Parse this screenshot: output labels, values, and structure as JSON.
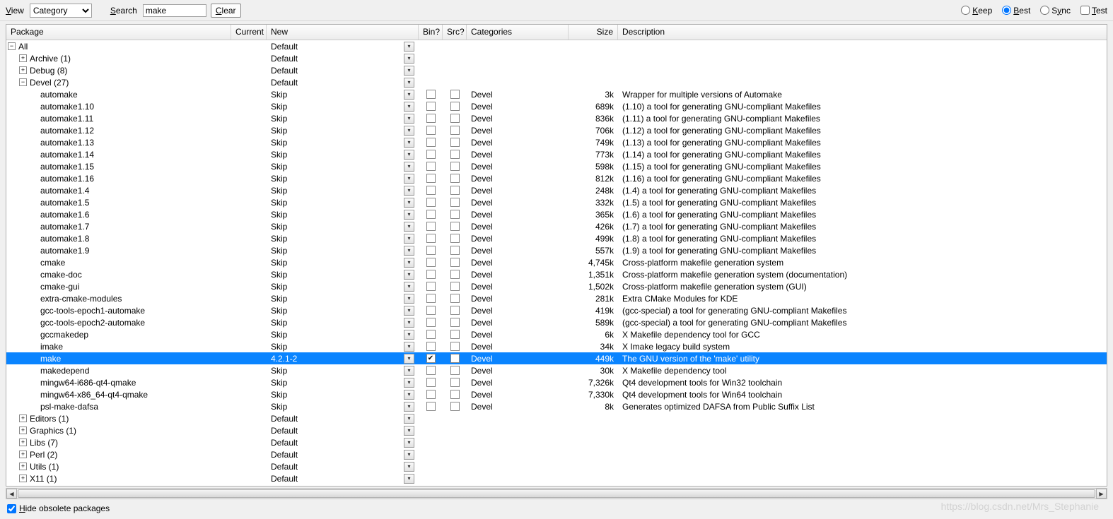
{
  "toolbar": {
    "view_label": "View",
    "view_value": "Category",
    "search_label": "Search",
    "search_value": "make",
    "clear_label": "Clear",
    "radio_keep": "Keep",
    "radio_best": "Best",
    "radio_sync": "Sync",
    "check_test": "Test"
  },
  "columns": {
    "package": "Package",
    "current": "Current",
    "new": "New",
    "bin": "Bin?",
    "src": "Src?",
    "categories": "Categories",
    "size": "Size",
    "description": "Description"
  },
  "rows": [
    {
      "type": "cat",
      "label": "All",
      "expanded": true,
      "indent": 0,
      "new": "Default"
    },
    {
      "type": "cat",
      "label": "Archive (1)",
      "expanded": false,
      "indent": 1,
      "new": "Default"
    },
    {
      "type": "cat",
      "label": "Debug (8)",
      "expanded": false,
      "indent": 1,
      "new": "Default"
    },
    {
      "type": "cat",
      "label": "Devel (27)",
      "expanded": true,
      "indent": 1,
      "new": "Default"
    },
    {
      "type": "pkg",
      "label": "automake",
      "new": "Skip",
      "cat": "Devel",
      "size": "3k",
      "desc": "Wrapper for multiple versions of Automake"
    },
    {
      "type": "pkg",
      "label": "automake1.10",
      "new": "Skip",
      "cat": "Devel",
      "size": "689k",
      "desc": "(1.10) a tool for generating GNU-compliant Makefiles"
    },
    {
      "type": "pkg",
      "label": "automake1.11",
      "new": "Skip",
      "cat": "Devel",
      "size": "836k",
      "desc": "(1.11) a tool for generating GNU-compliant Makefiles"
    },
    {
      "type": "pkg",
      "label": "automake1.12",
      "new": "Skip",
      "cat": "Devel",
      "size": "706k",
      "desc": "(1.12) a tool for generating GNU-compliant Makefiles"
    },
    {
      "type": "pkg",
      "label": "automake1.13",
      "new": "Skip",
      "cat": "Devel",
      "size": "749k",
      "desc": "(1.13) a tool for generating GNU-compliant Makefiles"
    },
    {
      "type": "pkg",
      "label": "automake1.14",
      "new": "Skip",
      "cat": "Devel",
      "size": "773k",
      "desc": "(1.14) a tool for generating GNU-compliant Makefiles"
    },
    {
      "type": "pkg",
      "label": "automake1.15",
      "new": "Skip",
      "cat": "Devel",
      "size": "598k",
      "desc": "(1.15) a tool for generating GNU-compliant Makefiles"
    },
    {
      "type": "pkg",
      "label": "automake1.16",
      "new": "Skip",
      "cat": "Devel",
      "size": "812k",
      "desc": "(1.16) a tool for generating GNU-compliant Makefiles"
    },
    {
      "type": "pkg",
      "label": "automake1.4",
      "new": "Skip",
      "cat": "Devel",
      "size": "248k",
      "desc": "(1.4) a tool for generating GNU-compliant Makefiles"
    },
    {
      "type": "pkg",
      "label": "automake1.5",
      "new": "Skip",
      "cat": "Devel",
      "size": "332k",
      "desc": "(1.5) a tool for generating GNU-compliant Makefiles"
    },
    {
      "type": "pkg",
      "label": "automake1.6",
      "new": "Skip",
      "cat": "Devel",
      "size": "365k",
      "desc": "(1.6) a tool for generating GNU-compliant Makefiles"
    },
    {
      "type": "pkg",
      "label": "automake1.7",
      "new": "Skip",
      "cat": "Devel",
      "size": "426k",
      "desc": "(1.7) a tool for generating GNU-compliant Makefiles"
    },
    {
      "type": "pkg",
      "label": "automake1.8",
      "new": "Skip",
      "cat": "Devel",
      "size": "499k",
      "desc": "(1.8) a tool for generating GNU-compliant Makefiles"
    },
    {
      "type": "pkg",
      "label": "automake1.9",
      "new": "Skip",
      "cat": "Devel",
      "size": "557k",
      "desc": "(1.9) a tool for generating GNU-compliant Makefiles"
    },
    {
      "type": "pkg",
      "label": "cmake",
      "new": "Skip",
      "cat": "Devel",
      "size": "4,745k",
      "desc": "Cross-platform makefile generation system"
    },
    {
      "type": "pkg",
      "label": "cmake-doc",
      "new": "Skip",
      "cat": "Devel",
      "size": "1,351k",
      "desc": "Cross-platform makefile generation system (documentation)"
    },
    {
      "type": "pkg",
      "label": "cmake-gui",
      "new": "Skip",
      "cat": "Devel",
      "size": "1,502k",
      "desc": "Cross-platform makefile generation system (GUI)"
    },
    {
      "type": "pkg",
      "label": "extra-cmake-modules",
      "new": "Skip",
      "cat": "Devel",
      "size": "281k",
      "desc": "Extra CMake Modules for KDE"
    },
    {
      "type": "pkg",
      "label": "gcc-tools-epoch1-automake",
      "new": "Skip",
      "cat": "Devel",
      "size": "419k",
      "desc": "(gcc-special) a tool for generating GNU-compliant Makefiles"
    },
    {
      "type": "pkg",
      "label": "gcc-tools-epoch2-automake",
      "new": "Skip",
      "cat": "Devel",
      "size": "589k",
      "desc": "(gcc-special) a tool for generating GNU-compliant Makefiles"
    },
    {
      "type": "pkg",
      "label": "gccmakedep",
      "new": "Skip",
      "cat": "Devel",
      "size": "6k",
      "desc": "X Makefile dependency tool for GCC"
    },
    {
      "type": "pkg",
      "label": "imake",
      "new": "Skip",
      "cat": "Devel",
      "size": "34k",
      "desc": "X Imake legacy build system"
    },
    {
      "type": "pkg",
      "label": "make",
      "new": "4.2.1-2",
      "cat": "Devel",
      "size": "449k",
      "desc": "The GNU version of the 'make' utility",
      "selected": true,
      "bin": true
    },
    {
      "type": "pkg",
      "label": "makedepend",
      "new": "Skip",
      "cat": "Devel",
      "size": "30k",
      "desc": "X Makefile dependency tool"
    },
    {
      "type": "pkg",
      "label": "mingw64-i686-qt4-qmake",
      "new": "Skip",
      "cat": "Devel",
      "size": "7,326k",
      "desc": "Qt4 development tools for Win32 toolchain"
    },
    {
      "type": "pkg",
      "label": "mingw64-x86_64-qt4-qmake",
      "new": "Skip",
      "cat": "Devel",
      "size": "7,330k",
      "desc": "Qt4 development tools for Win64 toolchain"
    },
    {
      "type": "pkg",
      "label": "psl-make-dafsa",
      "new": "Skip",
      "cat": "Devel",
      "size": "8k",
      "desc": "Generates optimized DAFSA from Public Suffix List"
    },
    {
      "type": "cat",
      "label": "Editors (1)",
      "expanded": false,
      "indent": 1,
      "new": "Default"
    },
    {
      "type": "cat",
      "label": "Graphics (1)",
      "expanded": false,
      "indent": 1,
      "new": "Default"
    },
    {
      "type": "cat",
      "label": "Libs (7)",
      "expanded": false,
      "indent": 1,
      "new": "Default"
    },
    {
      "type": "cat",
      "label": "Perl (2)",
      "expanded": false,
      "indent": 1,
      "new": "Default"
    },
    {
      "type": "cat",
      "label": "Utils (1)",
      "expanded": false,
      "indent": 1,
      "new": "Default"
    },
    {
      "type": "cat",
      "label": "X11 (1)",
      "expanded": false,
      "indent": 1,
      "new": "Default"
    }
  ],
  "footer": {
    "hide_obsolete": "Hide obsolete packages"
  },
  "watermark": "https://blog.csdn.net/Mrs_Stephanie"
}
